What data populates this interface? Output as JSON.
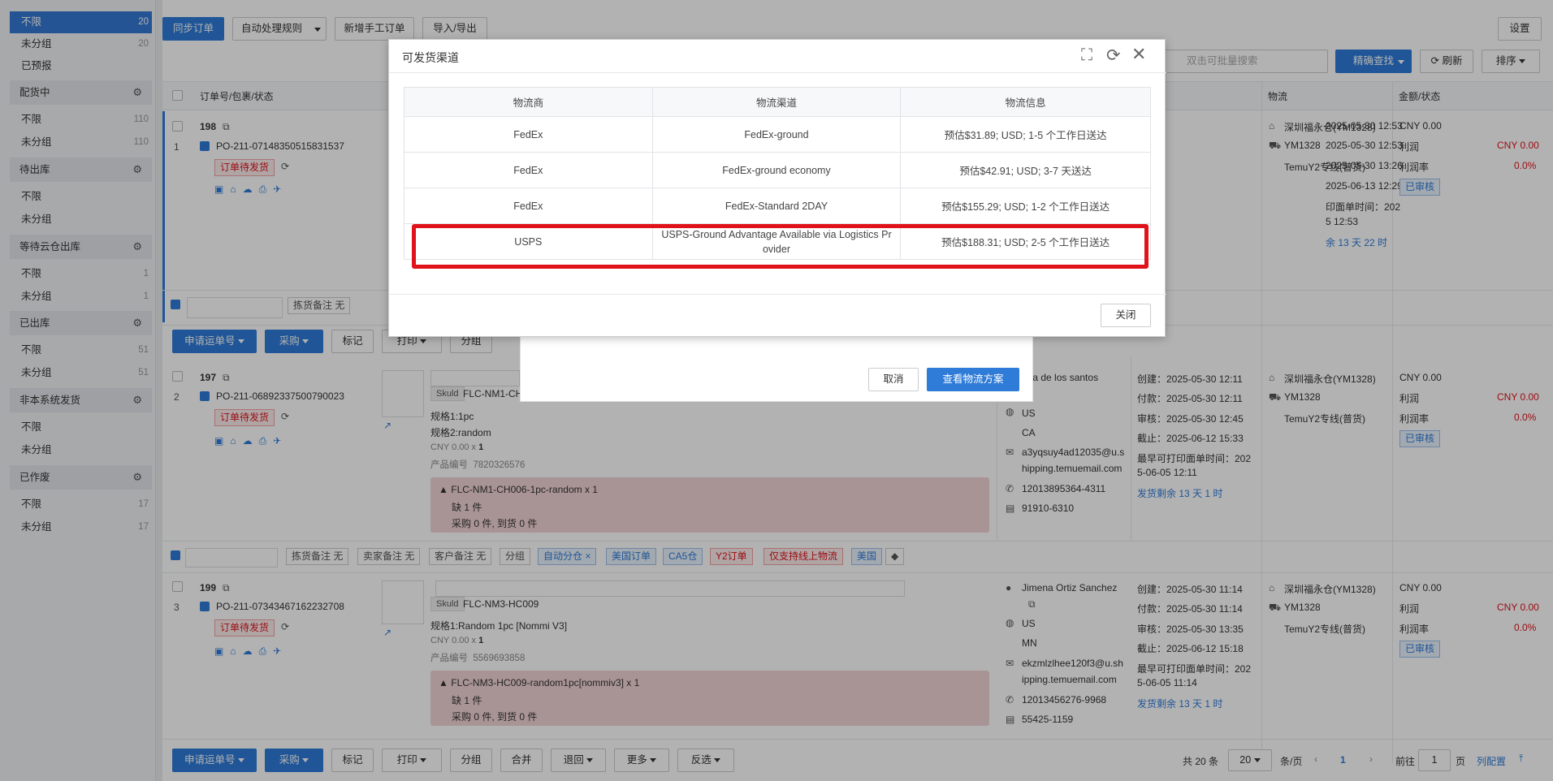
{
  "sidebar": {
    "items": [
      {
        "label": "不限",
        "count": "20"
      },
      {
        "label": "未分组",
        "count": "20"
      },
      {
        "label": "已预报",
        "count": ""
      }
    ],
    "groups": [
      {
        "title": "配货中",
        "items": [
          {
            "label": "不限",
            "count": "110"
          },
          {
            "label": "未分组",
            "count": "110"
          }
        ]
      },
      {
        "title": "待出库",
        "items": [
          {
            "label": "不限",
            "count": ""
          },
          {
            "label": "未分组",
            "count": ""
          }
        ]
      },
      {
        "title": "等待云仓出库",
        "items": [
          {
            "label": "不限",
            "count": "1"
          },
          {
            "label": "未分组",
            "count": "1"
          }
        ]
      },
      {
        "title": "已出库",
        "items": [
          {
            "label": "不限",
            "count": "51"
          },
          {
            "label": "未分组",
            "count": "51"
          }
        ]
      },
      {
        "title": "非本系统发货",
        "items": [
          {
            "label": "不限",
            "count": ""
          },
          {
            "label": "未分组",
            "count": ""
          }
        ]
      },
      {
        "title": "已作废",
        "items": [
          {
            "label": "不限",
            "count": "17"
          },
          {
            "label": "未分组",
            "count": "17"
          }
        ]
      }
    ]
  },
  "toolbar": {
    "sync": "同步订单",
    "auto_rules": "自动处理规则",
    "new_manual": "新增手工订单",
    "import_export": "导入/导出",
    "settings": "设置",
    "search_placeholder": "双击可批量搜索",
    "precise_search": "精确查找",
    "refresh": "刷新",
    "sort": "排序"
  },
  "table_header": {
    "order": "订单号/包裹/状态",
    "logistics": "物流",
    "amount": "金额/状态"
  },
  "modal": {
    "title": "可发货渠道",
    "columns": [
      "物流商",
      "物流渠道",
      "物流信息"
    ],
    "rows": [
      {
        "carrier": "FedEx",
        "channel": "FedEx-ground",
        "info": "预估$31.89; USD; 1-5 个工作日送达"
      },
      {
        "carrier": "FedEx",
        "channel": "FedEx-ground economy",
        "info": "预估$42.91; USD; 3-7 天送达"
      },
      {
        "carrier": "FedEx",
        "channel": "FedEx-Standard 2DAY",
        "info": "预估$155.29; USD; 1-2 个工作日送达"
      },
      {
        "carrier": "USPS",
        "channel": "USPS-Ground Advantage Available via Logistics Pr ovider",
        "info": "预估$188.31; USD; 2-5 个工作日送达"
      }
    ],
    "close": "关闭"
  },
  "subdialog": {
    "cancel": "取消",
    "view_plan": "查看物流方案"
  },
  "orders": [
    {
      "index": "1",
      "num": "198",
      "po": "PO-211-07148350515831537",
      "status": "订单待发货",
      "times": [
        "2025-05-30 12:53",
        "2025-05-30 12:53",
        "2025-05-30 13:26",
        "2025-06-13 12:29"
      ],
      "print_prefix": "印面单时间：202",
      "print_tail": "5 12:53",
      "remain": "余 13 天 22 时",
      "warehouse": "深圳福永仓(YM1328)",
      "wh_code": "YM1328",
      "line": "TemuY2专线(普货)",
      "cny": "CNY 0.00",
      "profit_label": "利润",
      "profit": "CNY 0.00",
      "rate_label": "利润率",
      "rate": "0.0%",
      "audit": "已审核"
    },
    {
      "index": "2",
      "num": "197",
      "po": "PO-211-06892337500790023",
      "status": "订单待发货",
      "sku_tag": "Skuld",
      "sku": "FLC-NM1-CH0",
      "spec1": "规格1:1pc",
      "spec2": "规格2:random",
      "price": "CNY 0.00 x",
      "qty": "1",
      "product_no_label": "产品编号",
      "product_no": "7820326576",
      "alert": "FLC-NM1-CH006-1pc-random x 1",
      "short": "缺 1 件",
      "purchase": "采购 0 件, 到货 0 件",
      "buyer": "ana de los santos",
      "country": "US",
      "state": "CA",
      "email": "a3yqsuy4ad12035@u.s",
      "email2": "hipping.temuemail.com",
      "phone": "12013895364-4311",
      "zip": "91910-6310",
      "created": "创建：2025-05-30 12:11",
      "paid": "付款：2025-05-30 12:11",
      "audited": "审核：2025-05-30 12:45",
      "deadline": "截止：2025-06-12 15:33",
      "print1": "最早可打印面单时间：202",
      "print2": "5-06-05 12:11",
      "remain": "发货剩余 13 天 1 时",
      "warehouse": "深圳福永仓(YM1328)",
      "wh_code": "YM1328",
      "line": "TemuY2专线(普货)",
      "cny": "CNY 0.00",
      "profit_label": "利润",
      "profit": "CNY 0.00",
      "rate_label": "利润率",
      "rate": "0.0%",
      "audit": "已审核"
    },
    {
      "index": "3",
      "num": "199",
      "po": "PO-211-07343467162232708",
      "status": "订单待发货",
      "sku_tag": "Skuld",
      "sku": "FLC-NM3-HC009",
      "spec1": "规格1:Random 1pc [Nommi V3]",
      "price": "CNY 0.00 x",
      "qty": "1",
      "product_no_label": "产品编号",
      "product_no": "5569693858",
      "alert": "FLC-NM3-HC009-random1pc[nommiv3] x 1",
      "short": "缺 1 件",
      "purchase": "采购 0 件, 到货 0 件",
      "buyer": "Jimena Ortiz Sanchez",
      "country": "US",
      "state": "MN",
      "email": "ekzmlzlhee120f3@u.sh",
      "email2": "ipping.temuemail.com",
      "phone": "12013456276-9968",
      "zip": "55425-1159",
      "created": "创建：2025-05-30 11:14",
      "paid": "付款：2025-05-30 11:14",
      "audited": "审核：2025-05-30 13:35",
      "deadline": "截止：2025-06-12 15:18",
      "print1": "最早可打印面单时间：202",
      "print2": "5-06-05 11:14",
      "remain": "发货剩余 13 天 1 时",
      "warehouse": "深圳福永仓(YM1328)",
      "wh_code": "YM1328",
      "line": "TemuY2专线(普货)",
      "cny": "CNY 0.00",
      "profit_label": "利润",
      "profit": "CNY 0.00",
      "rate_label": "利润率",
      "rate": "0.0%",
      "audit": "已审核"
    }
  ],
  "remarks": {
    "picking": "拣货备注 无",
    "seller": "卖家备注 无",
    "customer": "客户备注 无",
    "group": "分组",
    "tags": [
      "自动分仓",
      "美国订单",
      "CA5仓",
      "Y2订单",
      "仅支持线上物流",
      "美国"
    ]
  },
  "actions": {
    "apply_tracking": "申请运单号",
    "purchase": "采购",
    "mark": "标记",
    "print": "打印",
    "group": "分组",
    "merge": "合并",
    "return": "退回",
    "more": "更多",
    "invert": "反选"
  },
  "pagination": {
    "total": "共 20 条",
    "page_size": "20",
    "per_page": "条/页",
    "current": "1",
    "goto": "前往",
    "goto_value": "1",
    "page_unit": "页",
    "column_config": "列配置"
  }
}
